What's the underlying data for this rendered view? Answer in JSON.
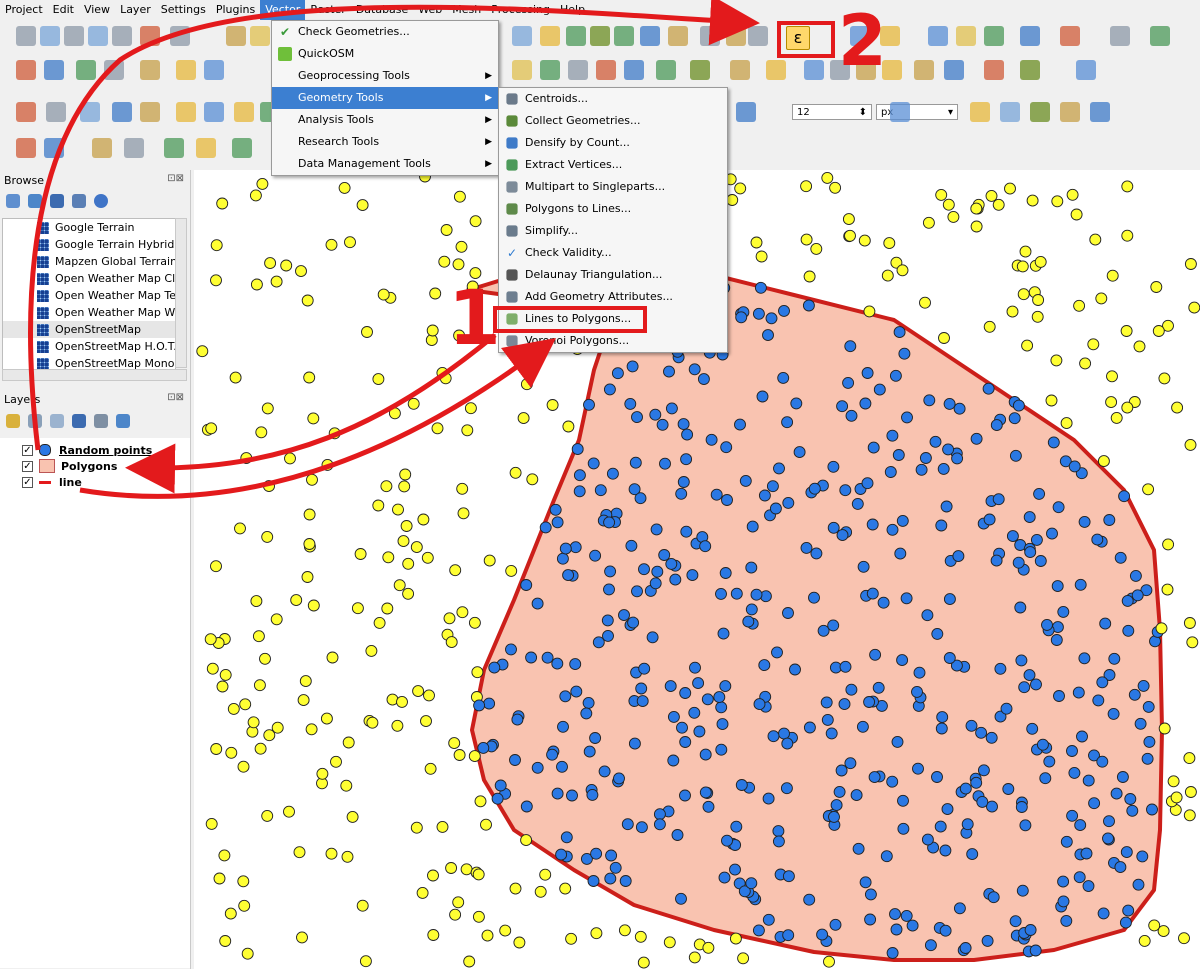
{
  "menubar": {
    "items": [
      "Project",
      "Edit",
      "View",
      "Layer",
      "Settings",
      "Plugins",
      "Vector",
      "Raster",
      "Database",
      "Web",
      "Mesh",
      "Processing",
      "Help"
    ]
  },
  "vector_menu": {
    "items": [
      {
        "label": "Check Geometries...",
        "icon": "check-icon",
        "arrow": false
      },
      {
        "label": "QuickOSM",
        "icon": "quickosm-icon",
        "arrow": false
      },
      {
        "label": "Geoprocessing Tools",
        "icon": "",
        "arrow": true
      },
      {
        "label": "Geometry Tools",
        "icon": "",
        "arrow": true
      },
      {
        "label": "Analysis Tools",
        "icon": "",
        "arrow": true
      },
      {
        "label": "Research Tools",
        "icon": "",
        "arrow": true
      },
      {
        "label": "Data Management Tools",
        "icon": "",
        "arrow": true
      }
    ]
  },
  "geometry_submenu": {
    "items": [
      {
        "label": "Centroids...",
        "icon": "centroids-icon"
      },
      {
        "label": "Collect Geometries...",
        "icon": "collect-icon"
      },
      {
        "label": "Densify by Count...",
        "icon": "densify-icon"
      },
      {
        "label": "Extract Vertices...",
        "icon": "vertices-icon"
      },
      {
        "label": "Multipart to Singleparts...",
        "icon": "multipart-icon"
      },
      {
        "label": "Polygons to Lines...",
        "icon": "polygons-to-lines-icon"
      },
      {
        "label": "Simplify...",
        "icon": "simplify-icon"
      },
      {
        "label": "Check Validity...",
        "icon": "check-validity-icon"
      },
      {
        "label": "Delaunay Triangulation...",
        "icon": "delaunay-icon"
      },
      {
        "label": "Add Geometry Attributes...",
        "icon": "attributes-icon"
      },
      {
        "label": "Lines to Polygons...",
        "icon": "lines-to-polygons-icon"
      },
      {
        "label": "Voronoi Polygons...",
        "icon": "voronoi-icon"
      }
    ]
  },
  "browser": {
    "title": "Browse",
    "items": [
      "Google Terrain",
      "Google Terrain Hybrid",
      "Mapzen Global Terrain",
      "Open Weather Map Clo",
      "Open Weather Map Ten",
      "Open Weather Map Wir",
      "OpenStreetMap",
      "OpenStreetMap H.O.T.",
      "OpenStreetMap Monoc"
    ]
  },
  "layers": {
    "title": "Layers",
    "items": [
      {
        "label": "Random points",
        "checked": "✓",
        "symbol": "blue-point"
      },
      {
        "label": "Polygons",
        "checked": "✓",
        "symbol": "salmon-fill"
      },
      {
        "label": "line",
        "checked": "✓",
        "symbol": "red-line"
      }
    ]
  },
  "toolbar": {
    "font_size_value": "12",
    "font_unit": "px",
    "expression_symbol": "ε"
  },
  "annotations": {
    "step1": "1",
    "step2": "2"
  },
  "colors": {
    "highlight_red": "#e31a1c",
    "polygon_fill": "#f9c3b0",
    "polygon_stroke": "#cc1f1a",
    "blue_point": "#2a78e4",
    "yellow_point": "#ffff33",
    "menu_active": "#3c7fd1"
  }
}
